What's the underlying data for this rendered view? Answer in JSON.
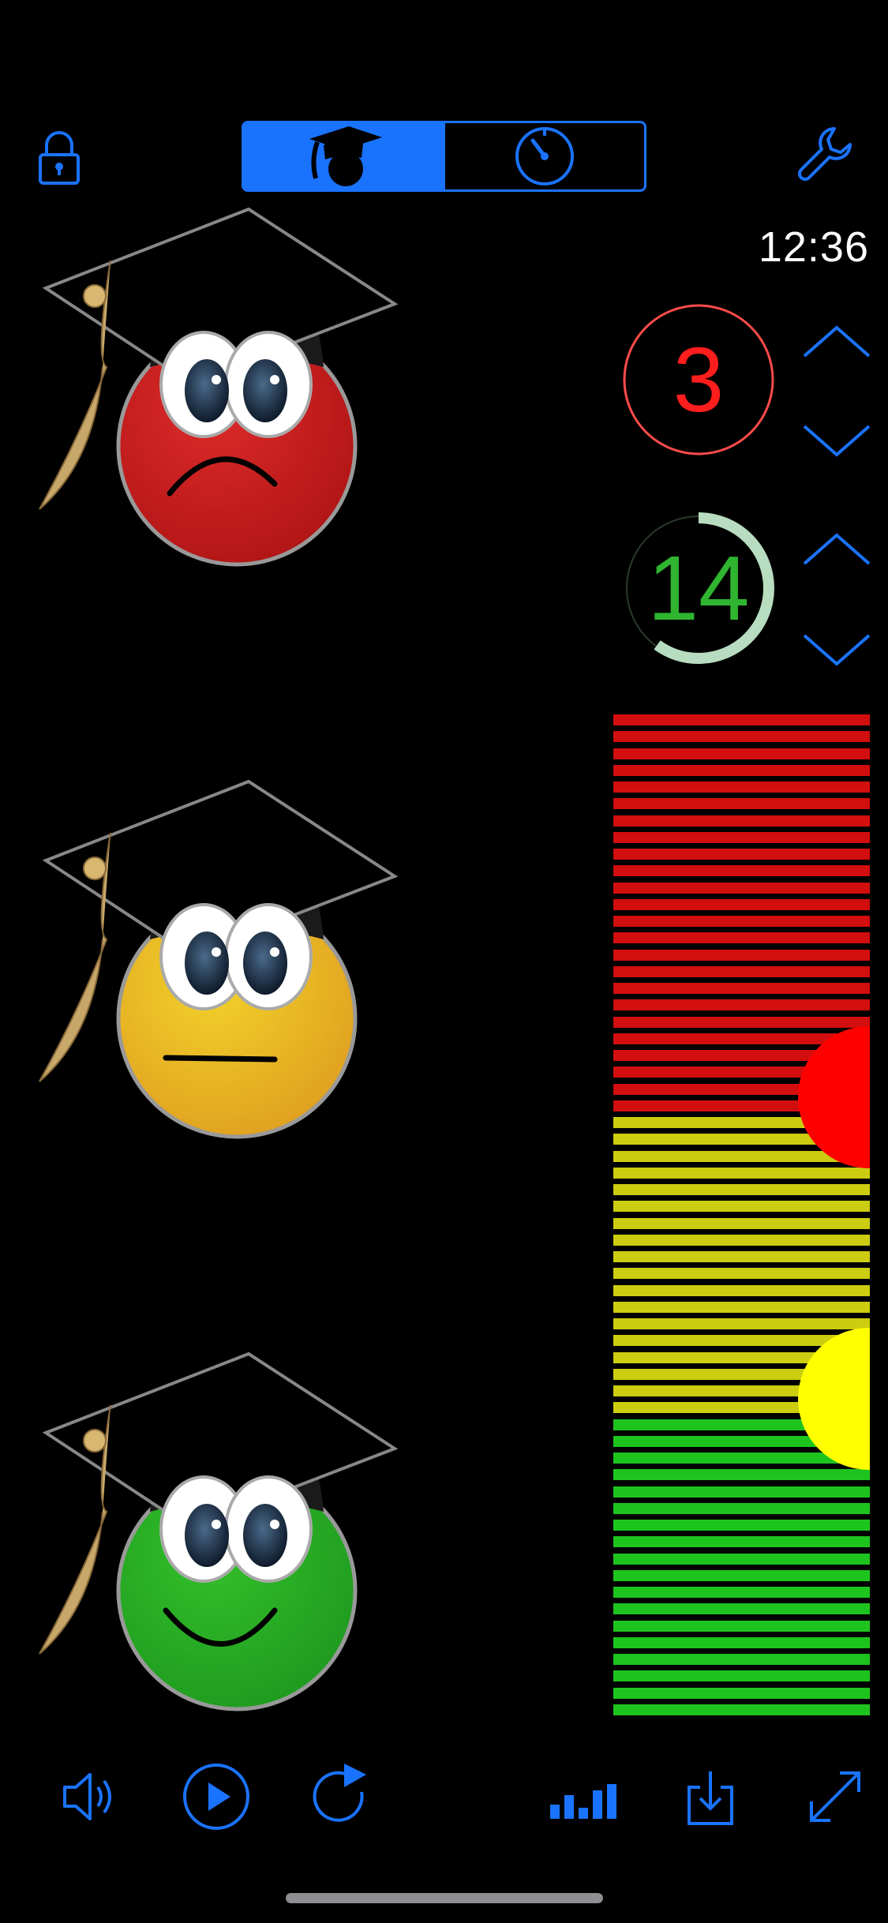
{
  "top_bar": {
    "lock_icon": "lock-icon",
    "settings_icon": "wrench-icon",
    "mode_segments": [
      {
        "icon": "graduation-cap-icon",
        "selected": true
      },
      {
        "icon": "stopwatch-icon",
        "selected": false
      }
    ]
  },
  "clock": {
    "time": "12:36"
  },
  "counters": [
    {
      "value": "3",
      "color": "#ff1d1d",
      "ring_color": "#ff4b4b",
      "ring_fraction": 1.0
    },
    {
      "value": "14",
      "color": "#2fb52f",
      "ring_color": "#b8dcbf",
      "ring_fraction": 0.6
    }
  ],
  "meter": {
    "zones": [
      {
        "name": "red",
        "color": "#d20e0e",
        "stripes": 24
      },
      {
        "name": "yellow",
        "color": "#cccc10",
        "stripes": 18
      },
      {
        "name": "green",
        "color": "#1ec41e",
        "stripes": 18
      }
    ],
    "markers": [
      {
        "color": "#ff0000",
        "level": 0.62
      },
      {
        "color": "#ffff00",
        "level": 0.32
      }
    ]
  },
  "faces": [
    {
      "mood": "sad",
      "color": "#de2a2a",
      "dark": "#b01515"
    },
    {
      "mood": "neutral",
      "color": "#f2d22a",
      "dark": "#e0a020"
    },
    {
      "mood": "happy",
      "color": "#33c02a",
      "dark": "#1f9a1f"
    }
  ],
  "toolbar": {
    "icons": [
      "speaker-icon",
      "play-icon",
      "reset-icon",
      "bar-chart-icon",
      "download-icon",
      "expand-icon"
    ]
  },
  "colors": {
    "accent": "#1a73ff",
    "background": "#000000"
  }
}
